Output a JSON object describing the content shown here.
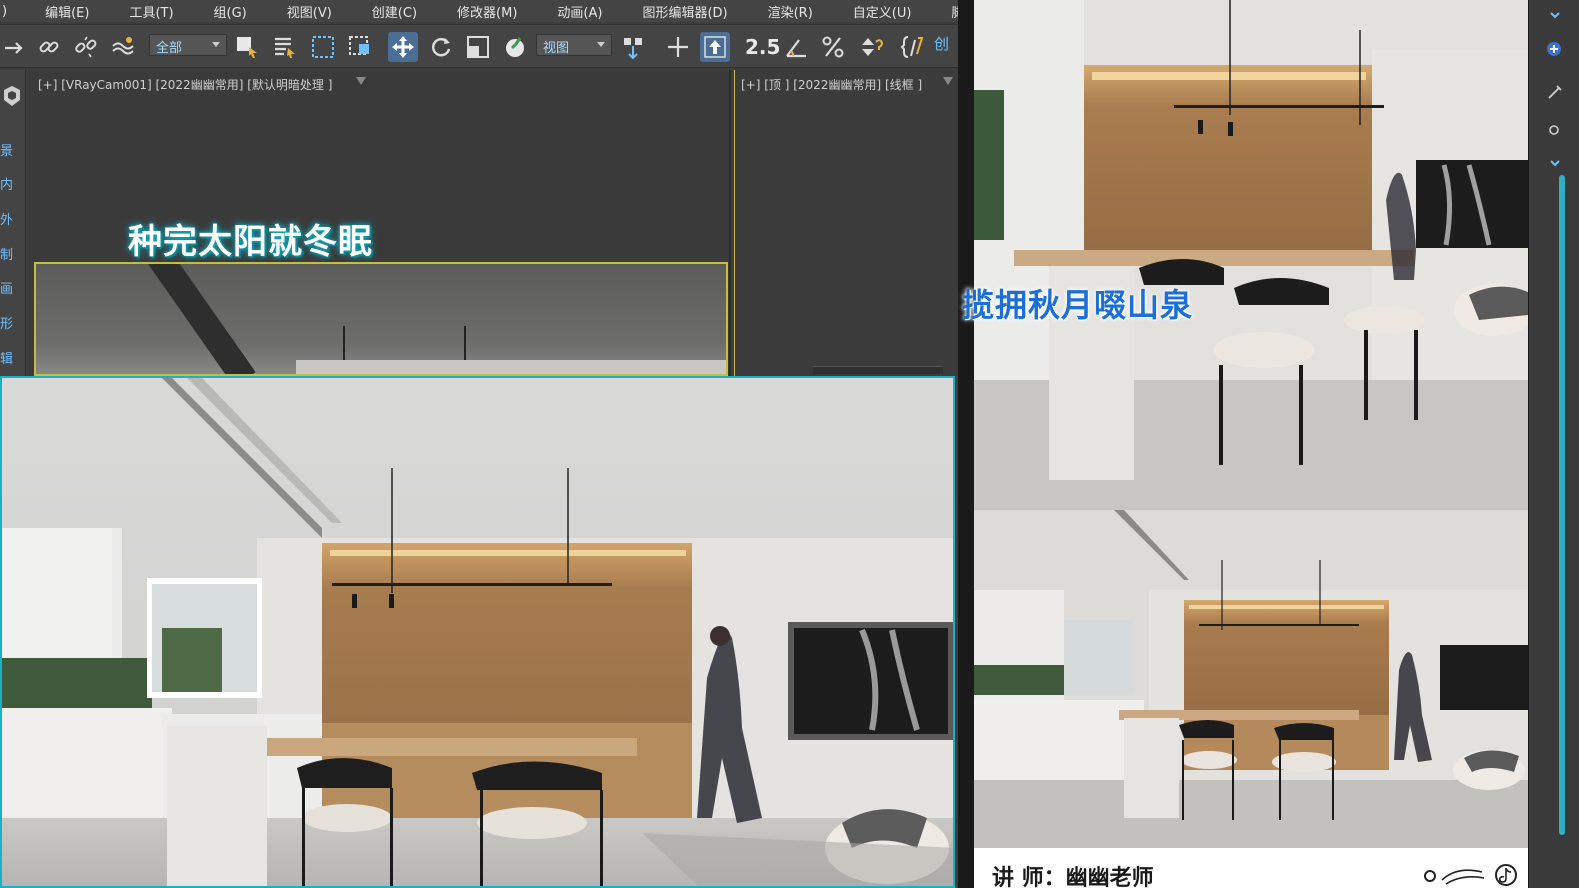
{
  "menubar": {
    "items": [
      ")",
      "编辑(E)",
      "工具(T)",
      "组(G)",
      "视图(V)",
      "创建(C)",
      "修改器(M)",
      "动画(A)",
      "图形编辑器(D)",
      "渲染(R)",
      "自定义(U)",
      "脚"
    ]
  },
  "toolbar": {
    "selection_filter": "全部",
    "ref_coord": "视图",
    "snap_toggle": "2.5",
    "create_selection_set": "创"
  },
  "command_panel": {
    "labels": [
      "景",
      "内",
      "外",
      "制",
      "画",
      "形",
      "辑"
    ]
  },
  "viewports": {
    "perspective_label": "[+] [VRayCam001] [2022幽幽常用] [默认明暗处理 ]",
    "top_label": "[+] [顶 ] [2022幽幽常用] [线框 ]"
  },
  "subtitles": {
    "line1": "种完太阳就冬眠",
    "line2": "揽拥秋月啜山泉"
  },
  "credit": {
    "label": "讲 师：幽幽老师"
  },
  "colors": {
    "accent_cyan": "#1ab0c8",
    "selection_yellow": "#c4bf3e",
    "subtitle_blue": "#1c6fd6",
    "toolbar_bg": "#444444"
  }
}
